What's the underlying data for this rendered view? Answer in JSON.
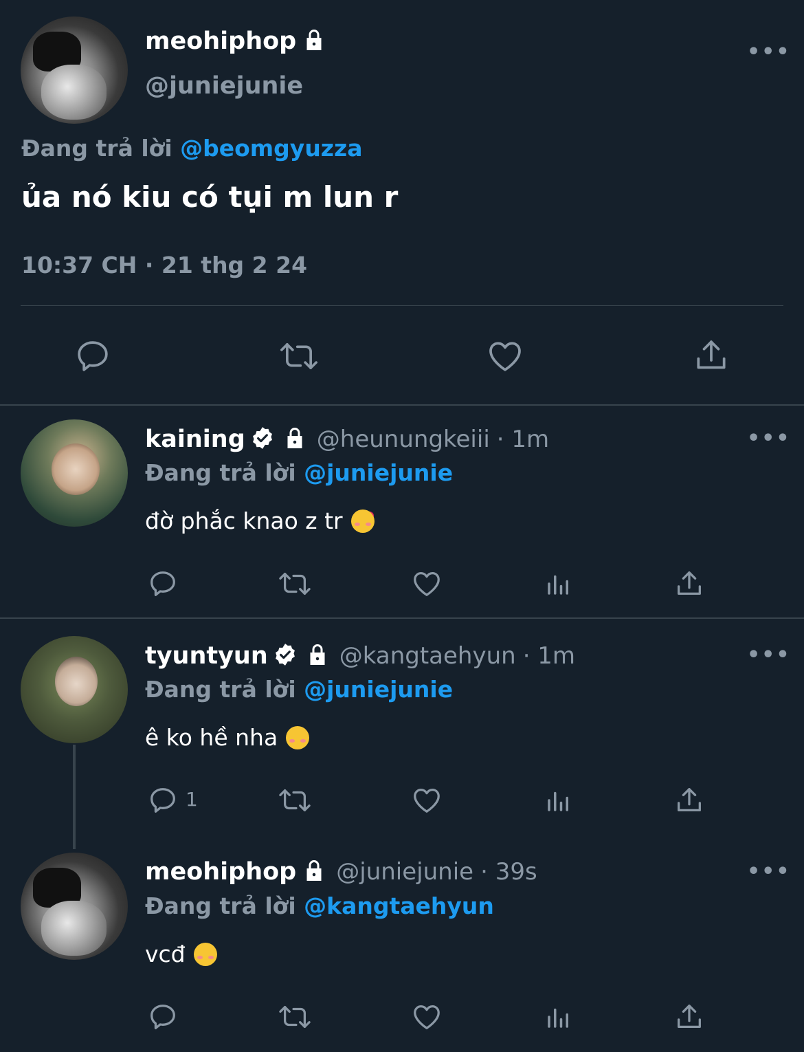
{
  "main_tweet": {
    "display_name": "meohiphop",
    "handle": "@juniejunie",
    "reply_prefix": "Đang trả lời",
    "reply_to": "@beomgyuzza",
    "text": "ủa nó kiu có tụi m lun r",
    "timestamp": "10:37 CH · 21 thg 2 24",
    "more": "•••"
  },
  "replies": [
    {
      "display_name": "kaining",
      "handle": "@heunungkeiii",
      "time": "· 1m",
      "reply_prefix": "Đang trả lời",
      "reply_to": "@juniejunie",
      "text": "đờ phắc knao z tr",
      "emoji": "smiling-face-with-hearts",
      "reply_count": "",
      "more": "•••"
    },
    {
      "display_name": "tyuntyun",
      "handle": "@kangtaehyun",
      "time": "· 1m",
      "reply_prefix": "Đang trả lời",
      "reply_to": "@juniejunie",
      "text": "ê ko hề nha",
      "emoji": "smiling-face",
      "reply_count": "1",
      "more": "•••"
    },
    {
      "display_name": "meohiphop",
      "handle": "@juniejunie",
      "time": "· 39s",
      "reply_prefix": "Đang trả lời",
      "reply_to": "@kangtaehyun",
      "text": "vcđ",
      "emoji": "smiling-face",
      "reply_count": "",
      "more": "•••"
    }
  ],
  "colors": {
    "background": "#15202b",
    "muted": "#8b98a5",
    "link": "#1d9bf0",
    "divider": "#38444d"
  }
}
